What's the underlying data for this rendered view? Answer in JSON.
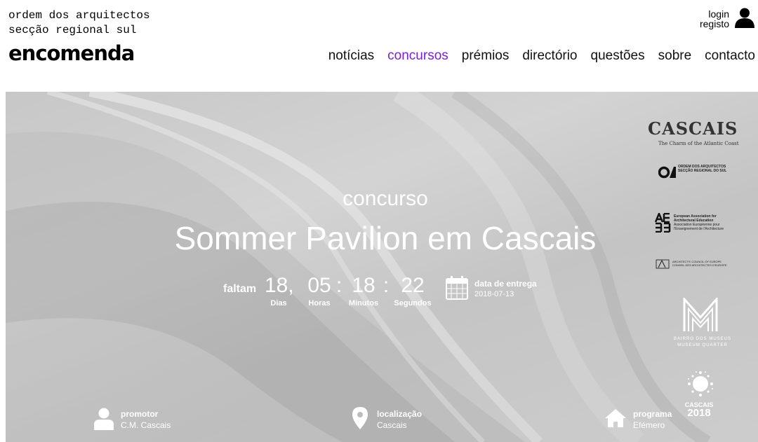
{
  "header": {
    "org_line1": "ordem dos arquitectos",
    "org_line2": "secção regional sul",
    "brand": "encomenda",
    "login": "login",
    "register": "registo"
  },
  "nav": {
    "items": [
      "notícias",
      "concursos",
      "prémios",
      "directório",
      "questões",
      "sobre",
      "contacto"
    ],
    "active": "concursos",
    "active_color": "#7b1fd0"
  },
  "hero": {
    "kicker": "concurso",
    "title": "Sommer Pavilion em Cascais",
    "countdown": {
      "prefix": "faltam",
      "days": "18,",
      "days_label": "Dias",
      "hours": "05",
      "hours_label": "Horas",
      "sep1": ":",
      "minutes": "18",
      "minutes_label": "Minutos",
      "sep2": ":",
      "seconds": "22",
      "seconds_label": "Segundos"
    },
    "deadline": {
      "label": "data de entrega",
      "date": "2018-07-13"
    }
  },
  "info": {
    "promoter": {
      "label": "promotor",
      "value": "C.M. Cascais",
      "icon": "person-icon"
    },
    "location": {
      "label": "localização",
      "value": "Cascais",
      "icon": "map-pin-icon"
    },
    "program": {
      "label": "programa",
      "value": "Efémero",
      "icon": "house-icon"
    }
  },
  "logos": {
    "cascais": "CASCAIS",
    "cascais_tagline": "The Charm of the Atlantic Coast",
    "oa_line1": "ORDEM DOS ARQUITECTOS",
    "oa_line2": "SECÇÃO REGIONAL DO SUL",
    "eaae_line1": "European Association for",
    "eaae_line2": "Architectural Education",
    "eaae_line3": "Association Européenne pour",
    "eaae_line4": "l'Enseignement de l'Architecture",
    "ace_line1": "ARCHITECTS' COUNCIL OF EUROPE",
    "ace_line2": "CONSEIL DES ARCHITECTES D'EUROPE",
    "museus_line1": "BAIRRO DOS MUSEUS",
    "museus_line2": "MUSEUM QUARTER",
    "cascais2018_line1": "CASCAIS",
    "cascais2018_line2": "2018"
  }
}
